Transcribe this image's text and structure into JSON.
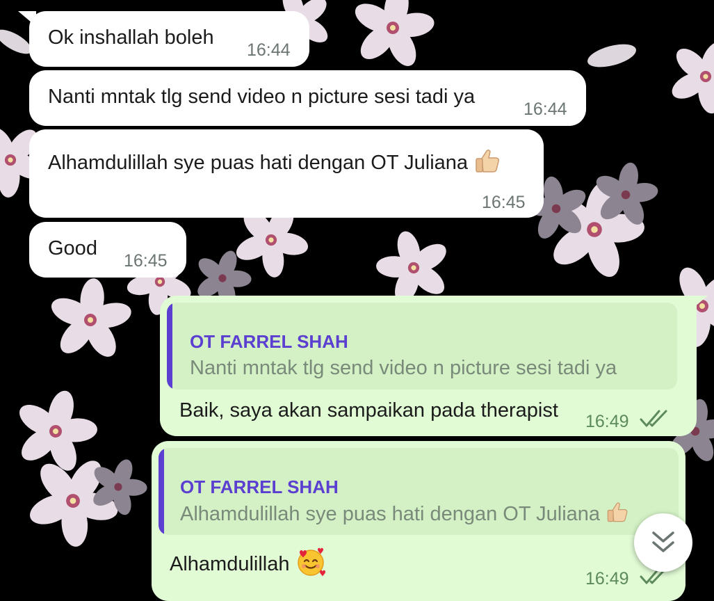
{
  "messages": {
    "m1": {
      "text": "Ok inshallah boleh",
      "time": "16:44"
    },
    "m2": {
      "text": "Nanti mntak tlg send video n picture sesi tadi ya",
      "time": "16:44"
    },
    "m3": {
      "text": "Alhamdulillah sye puas hati dengan OT Juliana",
      "emoji": "thumbs-up",
      "time": "16:45"
    },
    "m4": {
      "text": "Good",
      "time": "16:45"
    },
    "m5": {
      "quote_name": "OT FARREL SHAH",
      "quote_text": "Nanti mntak tlg send video n picture sesi tadi ya",
      "text": "Baik, saya akan sampaikan pada therapist",
      "time": "16:49",
      "status": "read-double-check"
    },
    "m6": {
      "quote_name": "OT FARREL SHAH",
      "quote_text": "Alhamdulillah sye puas hati dengan OT Juliana",
      "quote_emoji": "thumbs-up",
      "text": "Alhamdulillah",
      "emoji": "smiling-face-with-hearts",
      "time": "16:49",
      "status": "read-double-check"
    }
  },
  "scroll_button": {
    "icon": "double-chevron-down-icon"
  },
  "colors": {
    "incoming_bubble": "#ffffff",
    "outgoing_bubble": "#e1fbd5",
    "quote_accent": "#5b3fd0",
    "wallpaper": "#000000"
  }
}
